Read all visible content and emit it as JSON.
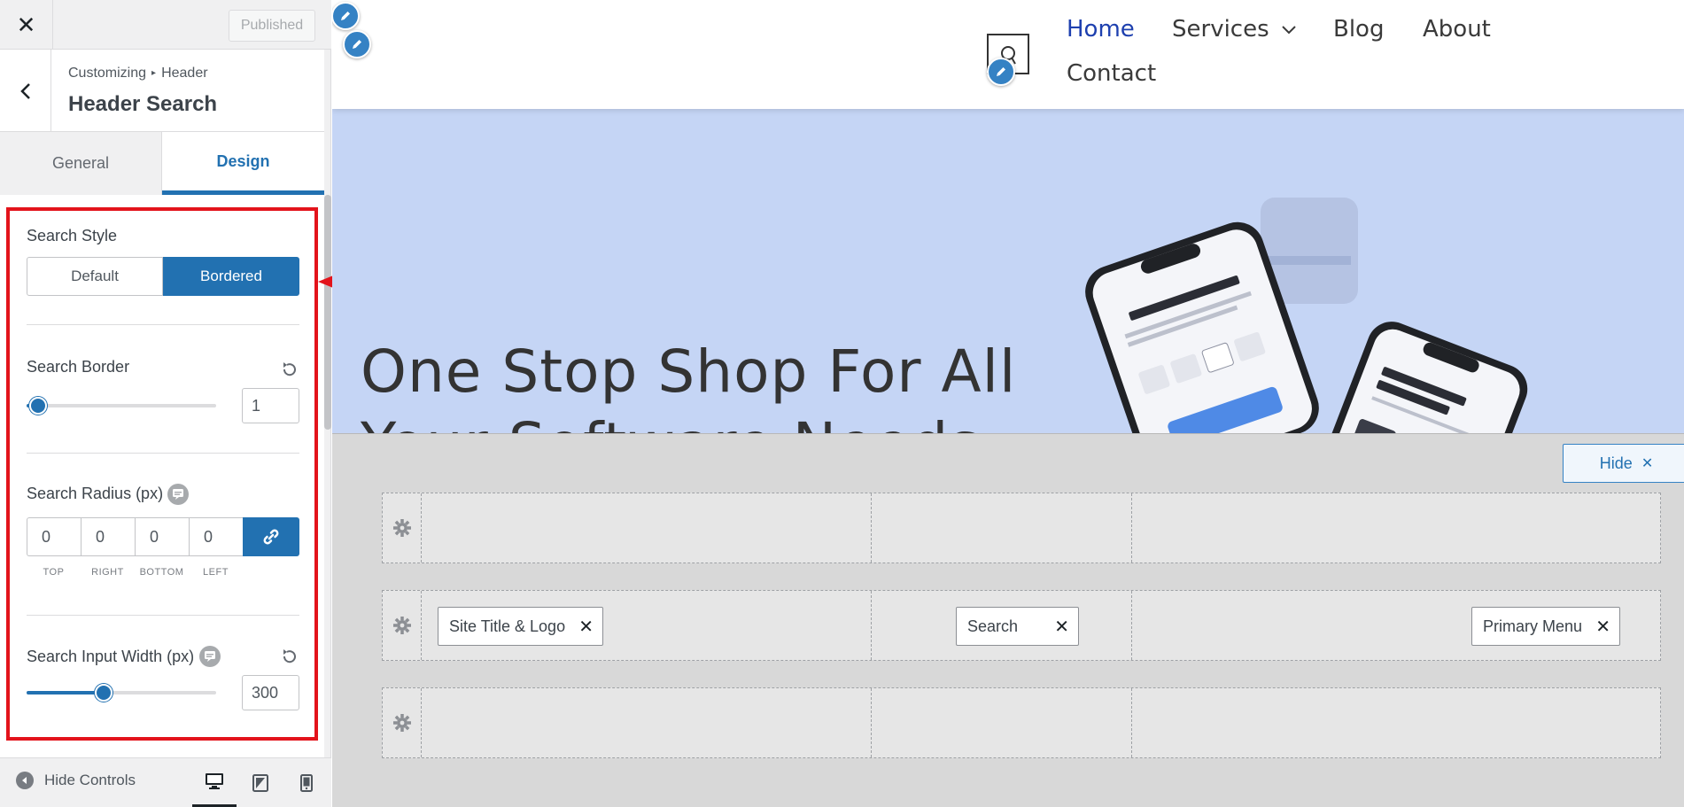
{
  "topbar": {
    "close": "✕",
    "published": "Published"
  },
  "section": {
    "crumb_parent": "Customizing",
    "crumb_sep": "▸",
    "crumb_child": "Header",
    "title": "Header Search"
  },
  "tabs": [
    {
      "label": "General"
    },
    {
      "label": "Design"
    }
  ],
  "search_style": {
    "label": "Search Style",
    "options": [
      "Default",
      "Bordered"
    ],
    "selected": "Bordered"
  },
  "search_border": {
    "label": "Search Border",
    "value": "1",
    "slider_fraction": 0.04
  },
  "search_radius": {
    "label": "Search Radius (px)",
    "values": [
      "0",
      "0",
      "0",
      "0"
    ],
    "captions": [
      "TOP",
      "RIGHT",
      "BOTTOM",
      "LEFT"
    ],
    "linked": true
  },
  "search_width": {
    "label": "Search Input Width (px)",
    "value": "300",
    "slider_fraction": 0.33
  },
  "footer": {
    "hide_controls": "Hide Controls"
  },
  "site_nav": {
    "items": [
      "Home",
      "Services",
      "Blog",
      "About",
      "Contact"
    ],
    "active": "Home"
  },
  "hero": {
    "title_line1": "One Stop Shop For All",
    "title_line2": "Your Software Needs"
  },
  "builder": {
    "hide_button": "Hide",
    "items": {
      "site_title_logo": "Site Title & Logo",
      "search": "Search",
      "primary_menu": "Primary Menu"
    },
    "remove_glyph": "✕"
  },
  "colors": {
    "accent": "#2271b1",
    "highlight": "#e3131b",
    "hero_bg": "#c5d5f5",
    "nav_active": "#1e40af"
  },
  "icons": [
    "close-icon",
    "back-chevron-icon",
    "reset-icon",
    "info-icon",
    "link-icon",
    "pencil-icon",
    "gear-icon",
    "desktop-icon",
    "tablet-icon",
    "mobile-icon",
    "chevron-down-icon"
  ]
}
